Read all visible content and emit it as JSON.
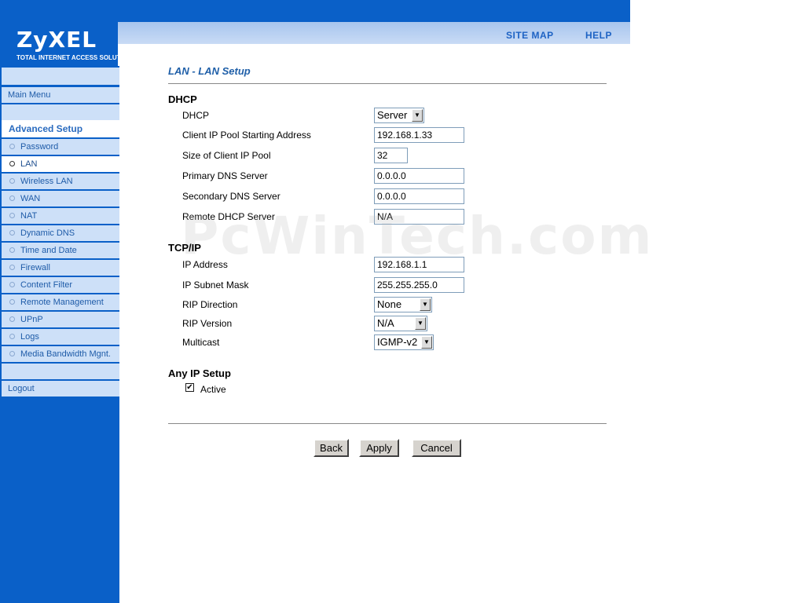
{
  "brand": {
    "logo": "ZyXEL",
    "tagline": "TOTAL INTERNET ACCESS SOLUTION"
  },
  "header": {
    "site_map": "SITE MAP",
    "help": "HELP"
  },
  "sidebar": {
    "main_menu": "Main Menu",
    "advanced_setup": "Advanced Setup",
    "items": [
      {
        "label": "Password"
      },
      {
        "label": "LAN"
      },
      {
        "label": "Wireless LAN"
      },
      {
        "label": "WAN"
      },
      {
        "label": "NAT"
      },
      {
        "label": "Dynamic DNS"
      },
      {
        "label": "Time and Date"
      },
      {
        "label": "Firewall"
      },
      {
        "label": "Content Filter"
      },
      {
        "label": "Remote Management"
      },
      {
        "label": "UPnP"
      },
      {
        "label": "Logs"
      },
      {
        "label": "Media Bandwidth Mgnt."
      }
    ],
    "active_item": "LAN",
    "logout": "Logout"
  },
  "page": {
    "title": "LAN - LAN Setup"
  },
  "dhcp": {
    "heading": "DHCP",
    "dhcp_label": "DHCP",
    "dhcp_value": "Server",
    "pool_start_label": "Client IP Pool Starting Address",
    "pool_start_value": "192.168.1.33",
    "pool_size_label": "Size of Client IP Pool",
    "pool_size_value": "32",
    "primary_dns_label": "Primary DNS Server",
    "primary_dns_value": "0.0.0.0",
    "secondary_dns_label": "Secondary DNS Server",
    "secondary_dns_value": "0.0.0.0",
    "remote_dhcp_label": "Remote DHCP Server",
    "remote_dhcp_value": "N/A"
  },
  "tcpip": {
    "heading": "TCP/IP",
    "ip_label": "IP Address",
    "ip_value": "192.168.1.1",
    "mask_label": "IP Subnet Mask",
    "mask_value": "255.255.255.0",
    "rip_direction_label": "RIP Direction",
    "rip_direction_value": "None",
    "rip_version_label": "RIP Version",
    "rip_version_value": "N/A",
    "multicast_label": "Multicast",
    "multicast_value": "IGMP-v2"
  },
  "any_ip": {
    "heading": "Any IP Setup",
    "active_label": "Active",
    "active_checked": true,
    "check_mark": "✔"
  },
  "buttons": {
    "back": "Back",
    "apply": "Apply",
    "cancel": "Cancel"
  },
  "watermark": "PcWinTech.com",
  "icons": {
    "dropdown": "▼"
  },
  "colors": {
    "brand_blue": "#0a60c8",
    "sidebar_item": "#cde0f8",
    "title_blue": "#1f5fa8"
  }
}
